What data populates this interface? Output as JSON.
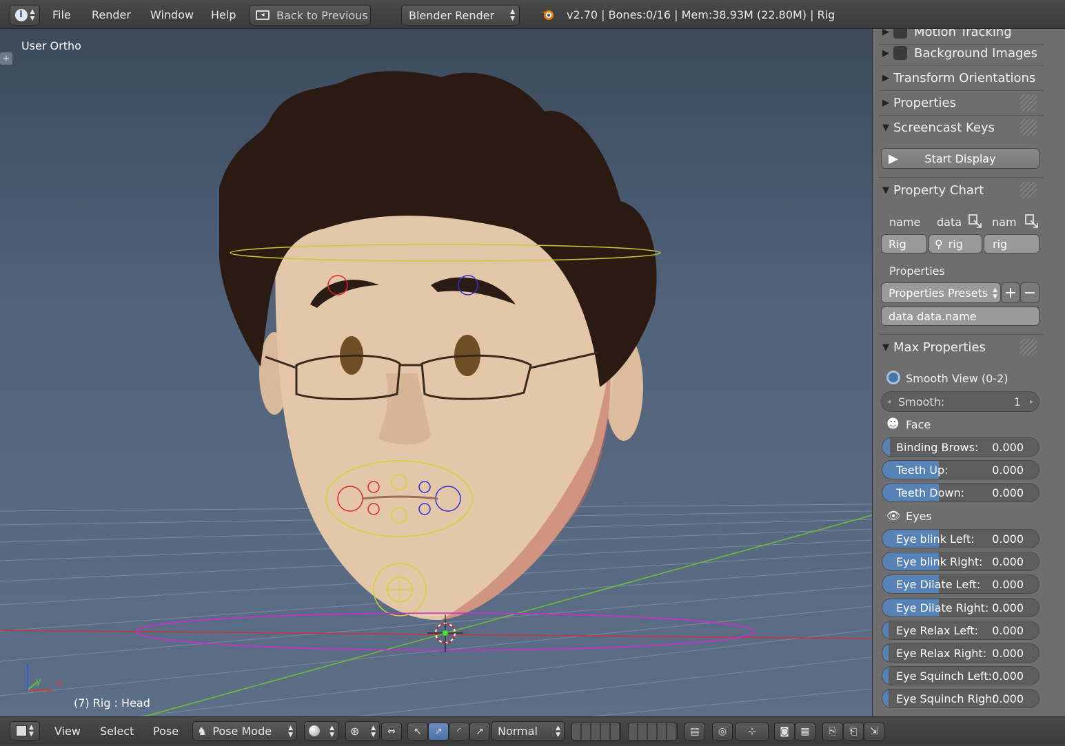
{
  "topbar": {
    "menu": [
      "File",
      "Render",
      "Window",
      "Help"
    ],
    "back_label": "Back to Previous",
    "engine": "Blender Render",
    "stats": "v2.70 | Bones:0/16  | Mem:38.93M (22.80M) | Rig"
  },
  "viewport": {
    "view_label": "User Ortho",
    "object_label": "(7) Rig : Head",
    "axis_x": "x",
    "axis_y": "y"
  },
  "sidebar": {
    "panels": {
      "motion_tracking": "Motion Tracking",
      "background_images": "Background Images",
      "transform_orientations": "Transform Orientations",
      "properties": "Properties",
      "screencast_keys": "Screencast Keys",
      "start_display": "Start Display",
      "property_chart": "Property Chart",
      "max_properties": "Max Properties"
    },
    "chart": {
      "col_name": "name",
      "col_data": "data",
      "col_nam": "nam",
      "val_name": "Rig",
      "val_data": "rig",
      "val_nam": "rig",
      "properties_label": "Properties",
      "presets": "Properties Presets",
      "data_path": "data data.name"
    },
    "max": {
      "smooth_view": "Smooth View (0-2)",
      "smooth_label": "Smooth:",
      "smooth_value": "1",
      "face_label": "Face",
      "eyes_label": "Eyes",
      "face_sliders": [
        {
          "label": "Binding Brows:",
          "value": "0.000",
          "fill": 0.05
        },
        {
          "label": "Teeth Up:",
          "value": "0.000",
          "fill": 0.36
        },
        {
          "label": "Teeth Down:",
          "value": "0.000",
          "fill": 0.36
        }
      ],
      "eye_sliders": [
        {
          "label": "Eye blink Left:",
          "value": "0.000",
          "fill": 0.36
        },
        {
          "label": "Eye blink Right:",
          "value": "0.000",
          "fill": 0.36
        },
        {
          "label": "Eye Dilate Left:",
          "value": "0.000",
          "fill": 0.36
        },
        {
          "label": "Eye Dilate Right:",
          "value": "0.000",
          "fill": 0.36
        },
        {
          "label": "Eye Relax Left:",
          "value": "0.000",
          "fill": 0.04
        },
        {
          "label": "Eye Relax Right:",
          "value": "0.000",
          "fill": 0.04
        },
        {
          "label": "Eye Squinch Left:",
          "value": "0.000",
          "fill": 0.04
        },
        {
          "label": "Eye Squinch Righ:",
          "value": "0.000",
          "fill": 0.04
        }
      ]
    }
  },
  "bottombar": {
    "menu": [
      "View",
      "Select",
      "Pose"
    ],
    "mode": "Pose Mode",
    "pivot": "Normal"
  },
  "colors": {
    "accent": "#5682b5",
    "panel": "#6e6e6e",
    "header": "#444444"
  }
}
